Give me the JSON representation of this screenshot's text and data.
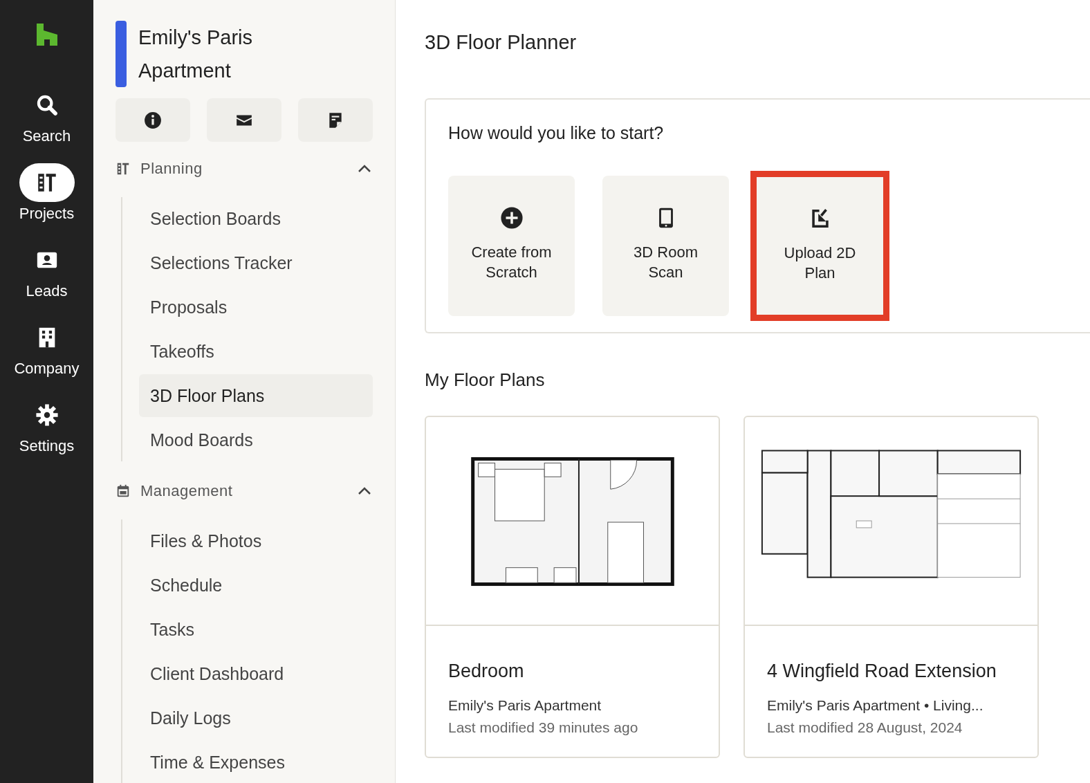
{
  "nav_rail": {
    "items": [
      {
        "label": "Search",
        "kind": "search",
        "selected": false
      },
      {
        "label": "Projects",
        "kind": "tools",
        "selected": true
      },
      {
        "label": "Leads",
        "kind": "badge",
        "selected": false
      },
      {
        "label": "Company",
        "kind": "building",
        "selected": false
      },
      {
        "label": "Settings",
        "kind": "gear",
        "selected": false
      }
    ]
  },
  "sidebar": {
    "project_title": "Emily's Paris Apartment",
    "action_buttons": [
      {
        "kind": "info"
      },
      {
        "kind": "mail"
      },
      {
        "kind": "note"
      }
    ],
    "sections": [
      {
        "title": "Planning",
        "kind": "tools",
        "expanded": true,
        "items": [
          {
            "label": "Selection Boards",
            "selected": false
          },
          {
            "label": "Selections Tracker",
            "selected": false
          },
          {
            "label": "Proposals",
            "selected": false
          },
          {
            "label": "Takeoffs",
            "selected": false
          },
          {
            "label": "3D Floor Plans",
            "selected": true
          },
          {
            "label": "Mood Boards",
            "selected": false
          }
        ]
      },
      {
        "title": "Management",
        "kind": "calendar",
        "expanded": true,
        "items": [
          {
            "label": "Files & Photos",
            "selected": false
          },
          {
            "label": "Schedule",
            "selected": false
          },
          {
            "label": "Tasks",
            "selected": false
          },
          {
            "label": "Client Dashboard",
            "selected": false
          },
          {
            "label": "Daily Logs",
            "selected": false
          },
          {
            "label": "Time & Expenses",
            "selected": false
          }
        ]
      }
    ]
  },
  "main": {
    "title": "3D Floor Planner",
    "start_panel": {
      "heading": "How would you like to start?",
      "options": [
        {
          "label": "Create from Scratch",
          "kind": "plus",
          "highlighted": false
        },
        {
          "label": "3D Room Scan",
          "kind": "tablet",
          "highlighted": false
        },
        {
          "label": "Upload 2D Plan",
          "kind": "upload",
          "highlighted": true
        }
      ]
    },
    "plans_heading": "My Floor Plans",
    "plans": [
      {
        "kind": "bedroom",
        "name": "Bedroom",
        "project": "Emily's Paris Apartment",
        "modified": "Last modified 39 minutes ago"
      },
      {
        "kind": "house",
        "name": "4 Wingfield Road Extension",
        "project": "Emily's Paris Apartment • Living...",
        "modified": "Last modified 28 August, 2024"
      }
    ]
  }
}
